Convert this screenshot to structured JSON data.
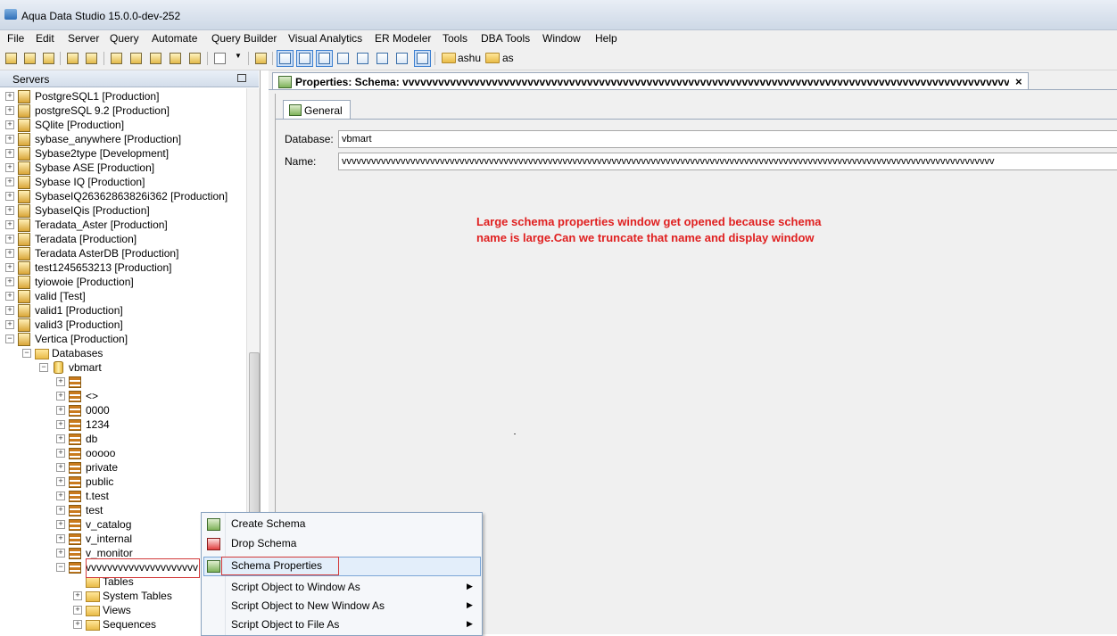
{
  "window": {
    "title": "Aqua Data Studio 15.0.0-dev-252"
  },
  "menu": [
    "File",
    "Edit",
    "Server",
    "Query",
    "Automate",
    "Query Builder",
    "Visual Analytics",
    "ER Modeler",
    "Tools",
    "DBA Tools",
    "Window",
    "Help"
  ],
  "toolbar": {
    "folder1": "ashu",
    "folder2": "as"
  },
  "servers_panel": {
    "title": "Servers"
  },
  "tree": [
    {
      "label": "PostgreSQL1 [Production]",
      "level": 0,
      "icon": "server-icon"
    },
    {
      "label": "postgreSQL 9.2 [Production]",
      "level": 0,
      "icon": "server-icon"
    },
    {
      "label": "SQlite [Production]",
      "level": 0,
      "icon": "server-icon"
    },
    {
      "label": "sybase_anywhere [Production]",
      "level": 0,
      "icon": "server-icon"
    },
    {
      "label": "Sybase2type [Development]",
      "level": 0,
      "icon": "server-icon"
    },
    {
      "label": "Sybase ASE [Production]",
      "level": 0,
      "icon": "server-icon"
    },
    {
      "label": "Sybase IQ [Production]",
      "level": 0,
      "icon": "server-icon"
    },
    {
      "label": "SybaseIQ26362863826i362 [Production]",
      "level": 0,
      "icon": "server-icon"
    },
    {
      "label": "SybaseIQis [Production]",
      "level": 0,
      "icon": "server-icon"
    },
    {
      "label": "Teradata_Aster [Production]",
      "level": 0,
      "icon": "server-icon"
    },
    {
      "label": "Teradata [Production]",
      "level": 0,
      "icon": "server-icon"
    },
    {
      "label": "Teradata AsterDB [Production]",
      "level": 0,
      "icon": "server-icon"
    },
    {
      "label": "test1245653213 [Production]",
      "level": 0,
      "icon": "server-icon"
    },
    {
      "label": "tyiowoie [Production]",
      "level": 0,
      "icon": "server-icon"
    },
    {
      "label": "valid [Test]",
      "level": 0,
      "icon": "server-icon"
    },
    {
      "label": "valid1 [Production]",
      "level": 0,
      "icon": "server-icon"
    },
    {
      "label": "valid3 [Production]",
      "level": 0,
      "icon": "server-icon"
    },
    {
      "label": "Vertica [Production]",
      "level": 0,
      "icon": "server-icon",
      "expanded": true
    },
    {
      "label": "Databases",
      "level": 1,
      "icon": "databases-folder-icon",
      "expanded": true
    },
    {
      "label": "vbmart",
      "level": 2,
      "icon": "database-icon",
      "expanded": true
    },
    {
      "label": "",
      "level": 3,
      "icon": "schema-icon"
    },
    {
      "label": "<>",
      "level": 3,
      "icon": "schema-icon"
    },
    {
      "label": "0000",
      "level": 3,
      "icon": "schema-icon"
    },
    {
      "label": "1234",
      "level": 3,
      "icon": "schema-icon"
    },
    {
      "label": "db",
      "level": 3,
      "icon": "schema-icon"
    },
    {
      "label": "ooooo",
      "level": 3,
      "icon": "schema-icon"
    },
    {
      "label": "private",
      "level": 3,
      "icon": "schema-icon"
    },
    {
      "label": "public",
      "level": 3,
      "icon": "schema-icon"
    },
    {
      "label": "t.test",
      "level": 3,
      "icon": "schema-icon"
    },
    {
      "label": "test",
      "level": 3,
      "icon": "schema-icon"
    },
    {
      "label": "v_catalog",
      "level": 3,
      "icon": "schema-icon"
    },
    {
      "label": "v_internal",
      "level": 3,
      "icon": "schema-icon"
    },
    {
      "label": "v_monitor",
      "level": 3,
      "icon": "schema-icon"
    },
    {
      "label": "vvvvvvvvvvvvvvvvvvvvv",
      "level": 3,
      "icon": "schema-icon",
      "expanded": true
    },
    {
      "label": "Tables",
      "level": 4,
      "icon": "folder-icon",
      "noexp": true
    },
    {
      "label": "System Tables",
      "level": 4,
      "icon": "folder-icon"
    },
    {
      "label": "Views",
      "level": 4,
      "icon": "folder-icon"
    },
    {
      "label": "Sequences",
      "level": 4,
      "icon": "folder-icon"
    }
  ],
  "properties": {
    "tab_title": "Properties: Schema: vvvvvvvvvvvvvvvvvvvvvvvvvvvvvvvvvvvvvvvvvvvvvvvvvvvvvvvvvvvvvvvvvvvvvvvvvvvvvvvvvvvvvvvvvvvvvvvvvvvvvvvvvvvvvvvvv",
    "close": "×",
    "general_tab": "General",
    "database_label": "Database:",
    "database_value": "vbmart",
    "name_label": "Name:",
    "name_value": "vvvvvvvvvvvvvvvvvvvvvvvvvvvvvvvvvvvvvvvvvvvvvvvvvvvvvvvvvvvvvvvvvvvvvvvvvvvvvvvvvvvvvvvvvvvvvvvvvvvvvvvvvvvvvvvvvvvvvvvvvvvvvvvvvvvvv"
  },
  "annotation": "Large schema properties window get opened because schema name is large.Can we truncate that name and display window",
  "context_menu": {
    "items": [
      {
        "label": "Create Schema",
        "icon": "create-schema-icon"
      },
      {
        "label": "Drop Schema",
        "icon": "drop-schema-icon"
      },
      {
        "label": "Schema Properties",
        "icon": "schema-properties-icon",
        "highlighted": true
      },
      {
        "label": "Script Object to Window As",
        "submenu": true
      },
      {
        "label": "Script Object to New Window As",
        "submenu": true
      },
      {
        "label": "Script Object to File As",
        "submenu": true
      }
    ]
  }
}
